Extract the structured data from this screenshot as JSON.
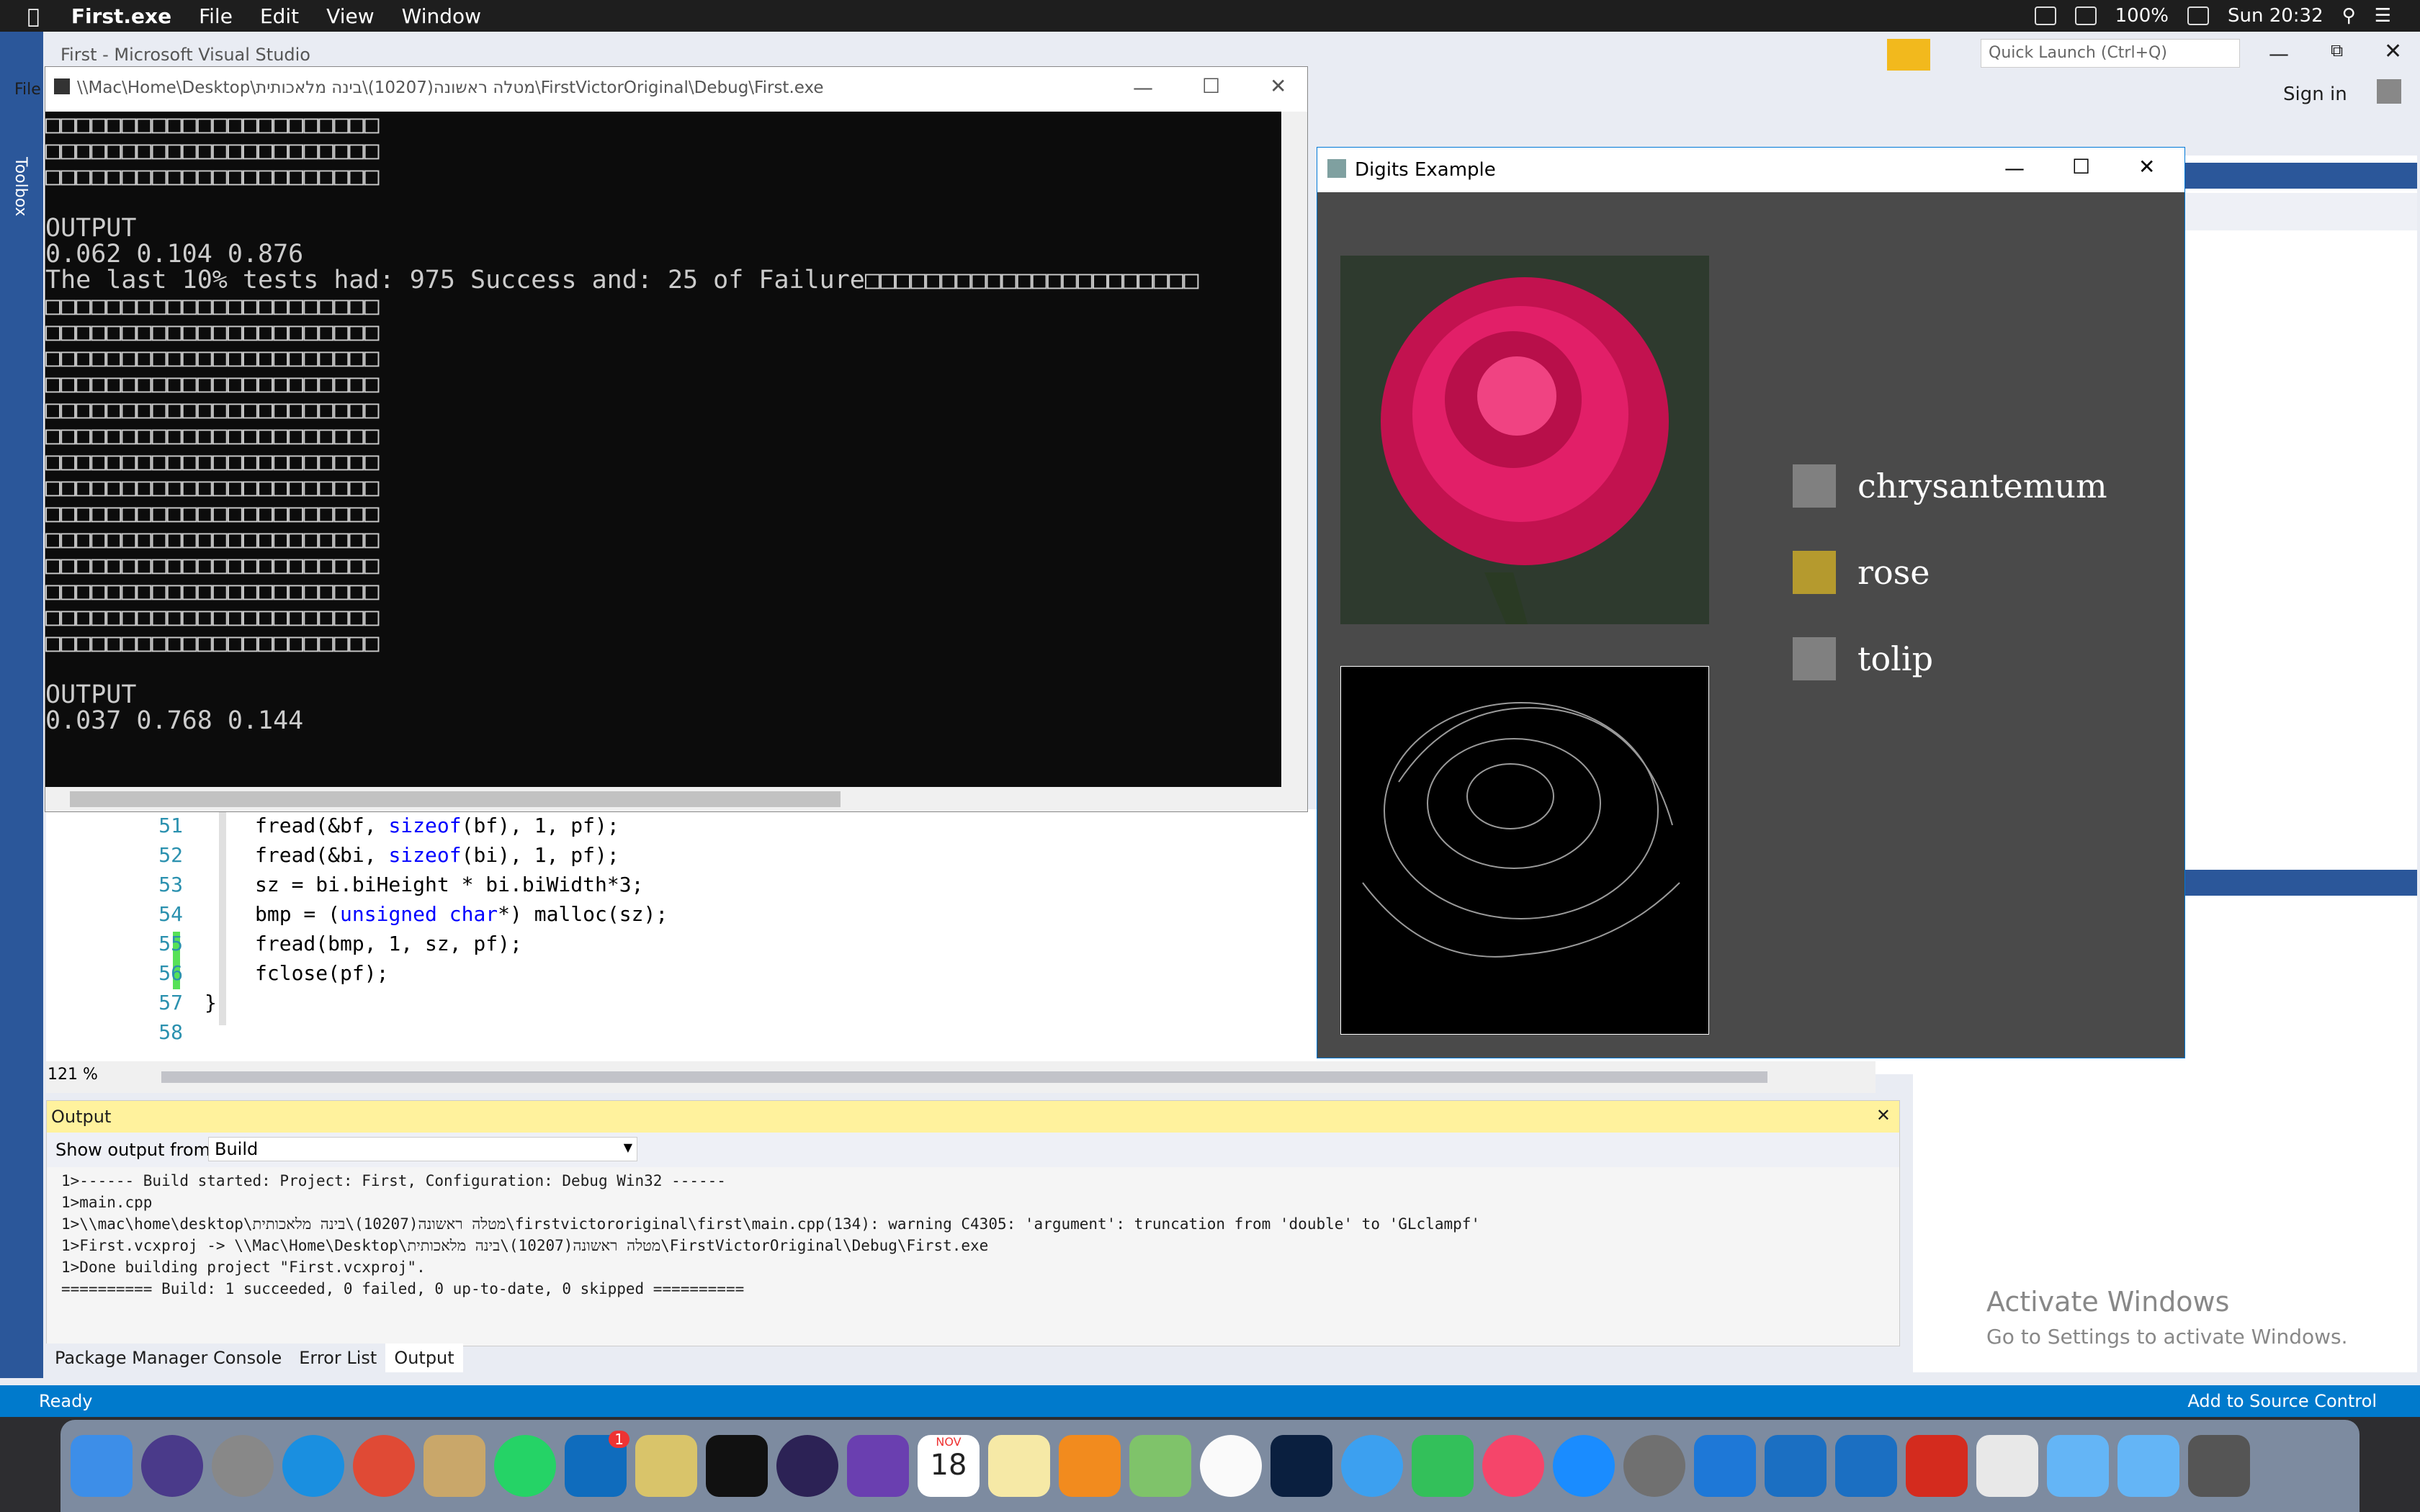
{
  "menubar": {
    "app": "First.exe",
    "items": [
      "File",
      "Edit",
      "View",
      "Window"
    ],
    "battery": "100%",
    "time": "Sun 20:32"
  },
  "vs": {
    "title": "First - Microsoft Visual Studio",
    "menu_file": "File",
    "toolbox": "Toolbox",
    "quick_launch": "Quick Launch (Ctrl+Q)",
    "sign_in": "Sign in",
    "zoom": "121 %",
    "status": "Ready",
    "source_control": "Add to Source Control",
    "activate_title": "Activate Windows",
    "activate_sub": "Go to Settings to activate Windows."
  },
  "editor": {
    "lines": [
      {
        "num": "51",
        "pre": "fread(&bf, ",
        "kw": "sizeof",
        "post": "(bf), 1, pf);"
      },
      {
        "num": "52",
        "pre": "fread(&bi, ",
        "kw": "sizeof",
        "post": "(bi), 1, pf);"
      },
      {
        "num": "53",
        "pre": "sz = bi.biHeight * bi.biWidth*3;",
        "kw": "",
        "post": ""
      },
      {
        "num": "54",
        "pre": "bmp = (",
        "kw": "unsigned char",
        "post": "*) malloc(sz);"
      },
      {
        "num": "55",
        "pre": "fread(bmp, 1, sz, pf);",
        "kw": "",
        "post": ""
      },
      {
        "num": "56",
        "pre": "fclose(pf);",
        "kw": "",
        "post": ""
      },
      {
        "num": "57",
        "pre": "}",
        "kw": "",
        "post": ""
      },
      {
        "num": "58",
        "pre": "",
        "kw": "",
        "post": ""
      }
    ]
  },
  "output": {
    "title": "Output",
    "show_from_label": "Show output from:",
    "show_from_value": "Build",
    "lines": [
      "1>------ Build started: Project: First, Configuration: Debug Win32 ------",
      "1>main.cpp",
      "1>\\\\mac\\home\\desktop\\מטלה ראשונה(10207)\\בינה מלאכותית\\firstvictororiginal\\first\\main.cpp(134): warning C4305: 'argument': truncation from 'double' to 'GLclampf'",
      "1>First.vcxproj -> \\\\Mac\\Home\\Desktop\\מטלה ראשונה(10207)\\בינה מלאכותית\\FirstVictorOriginal\\Debug\\First.exe",
      "1>Done building project \"First.vcxproj\".",
      "========== Build: 1 succeeded, 0 failed, 0 up-to-date, 0 skipped =========="
    ],
    "tabs": [
      "Package Manager Console",
      "Error List",
      "Output"
    ]
  },
  "console": {
    "title": "\\\\Mac\\Home\\Desktop\\מטלה ראשונה(10207)\\בינה מלאכותית\\FirstVictorOriginal\\Debug\\First.exe",
    "text": "□□□□□□□□□□□□□□□□□□□□□□\n□□□□□□□□□□□□□□□□□□□□□□\n□□□□□□□□□□□□□□□□□□□□□□\n\nOUTPUT\n0.062 0.104 0.876\nThe last 10% tests had: 975 Success and: 25 of Failure□□□□□□□□□□□□□□□□□□□□□□\n□□□□□□□□□□□□□□□□□□□□□□\n□□□□□□□□□□□□□□□□□□□□□□\n□□□□□□□□□□□□□□□□□□□□□□\n□□□□□□□□□□□□□□□□□□□□□□\n□□□□□□□□□□□□□□□□□□□□□□\n□□□□□□□□□□□□□□□□□□□□□□\n□□□□□□□□□□□□□□□□□□□□□□\n□□□□□□□□□□□□□□□□□□□□□□\n□□□□□□□□□□□□□□□□□□□□□□\n□□□□□□□□□□□□□□□□□□□□□□\n□□□□□□□□□□□□□□□□□□□□□□\n□□□□□□□□□□□□□□□□□□□□□□\n□□□□□□□□□□□□□□□□□□□□□□\n□□□□□□□□□□□□□□□□□□□□□□\n\nOUTPUT\n0.037 0.768 0.144"
  },
  "digits": {
    "title": "Digits Example",
    "legend": [
      {
        "label": "chrysantemum",
        "color": "#808080"
      },
      {
        "label": "rose",
        "color": "#b59a2e"
      },
      {
        "label": "tolip",
        "color": "#808080"
      }
    ]
  },
  "dock": {
    "calendar_month": "NOV",
    "calendar_day": "18",
    "outlook_badge": "1"
  }
}
